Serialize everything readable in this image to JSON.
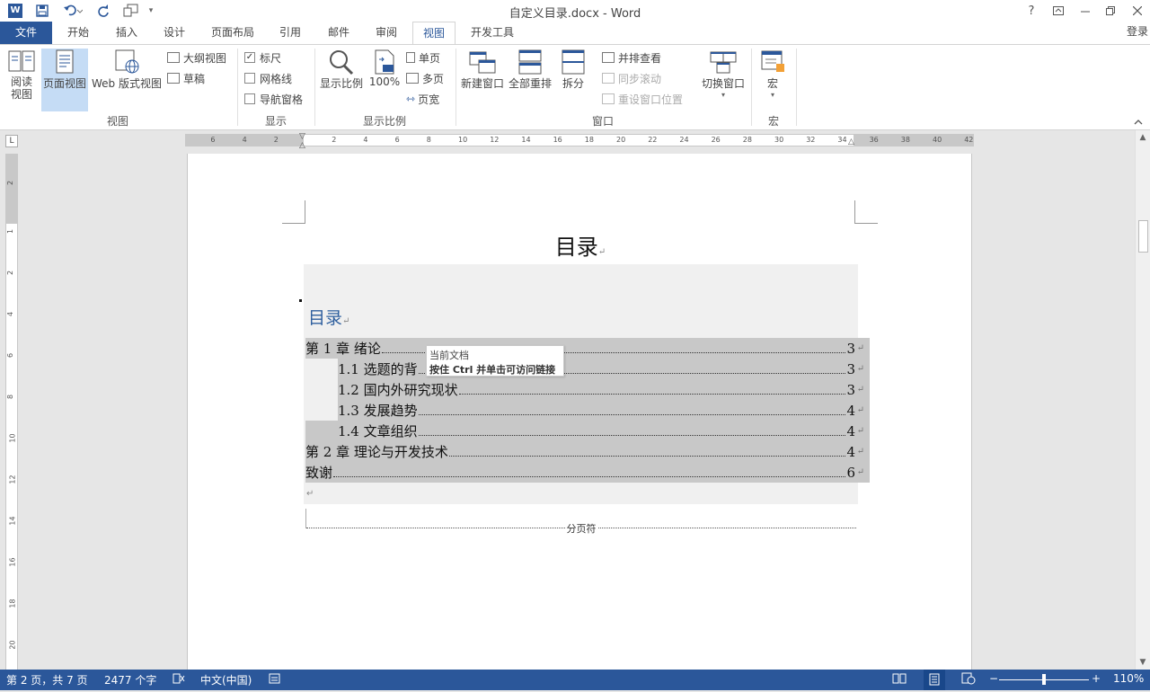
{
  "window": {
    "title": "自定义目录.docx - Word",
    "help": "?",
    "login": "登录"
  },
  "qat": {
    "word_icon": "W"
  },
  "tabs": [
    "文件",
    "开始",
    "插入",
    "设计",
    "页面布局",
    "引用",
    "邮件",
    "审阅",
    "视图",
    "开发工具"
  ],
  "ribbon": {
    "views": {
      "read": "阅读\n视图",
      "print_layout": "页面视图",
      "web_layout": "Web 版式视图",
      "outline": "大纲视图",
      "draft": "草稿",
      "label": "视图"
    },
    "show": {
      "ruler": "标尺",
      "ruler_checked": true,
      "gridlines": "网格线",
      "nav_pane": "导航窗格",
      "label": "显示"
    },
    "zoom": {
      "zoom": "显示比例",
      "hundred": "100%",
      "one_page": "单页",
      "multi_page": "多页",
      "page_width": "页宽",
      "label": "显示比例"
    },
    "window": {
      "new_window": "新建窗口",
      "arrange_all": "全部重排",
      "split": "拆分",
      "side_by_side": "并排查看",
      "sync_scroll": "同步滚动",
      "reset_position": "重设窗口位置",
      "switch_windows": "切换窗口",
      "label": "窗口"
    },
    "macros": {
      "macros": "宏",
      "label": "宏"
    }
  },
  "ruler": {
    "h_labels": [
      "6",
      "4",
      "2",
      "2",
      "4",
      "6",
      "8",
      "10",
      "12",
      "14",
      "16",
      "18",
      "20",
      "22",
      "24",
      "26",
      "28",
      "30",
      "32",
      "34",
      "36",
      "38",
      "40",
      "42"
    ],
    "v_labels": [
      "2",
      "1",
      "2",
      "4",
      "6",
      "8",
      "10",
      "12",
      "14",
      "16",
      "18",
      "20"
    ]
  },
  "document": {
    "title": "目录",
    "toc_heading": "目录",
    "toc": [
      {
        "text": "第 1 章  绪论",
        "page": "3",
        "indent": false
      },
      {
        "text": "1.1 选题的背",
        "page": "3",
        "indent": true
      },
      {
        "text": "1.2 国内外研究现状",
        "page": "3",
        "indent": true
      },
      {
        "text": "1.3 发展趋势",
        "page": "4",
        "indent": true
      },
      {
        "text": "1.4 文章组织",
        "page": "4",
        "indent": true
      },
      {
        "text": "第 2 章   理论与开发技术",
        "page": "4",
        "indent": false
      },
      {
        "text": "致谢",
        "page": "6",
        "indent": false
      }
    ],
    "tooltip": {
      "line1": "当前文档",
      "line2": "按住 Ctrl 并单击可访问链接"
    },
    "page_break": "分页符",
    "para_mark": "↵"
  },
  "status": {
    "page": "第 2 页，共 7 页",
    "words": "2477 个字",
    "language": "中文(中国)",
    "zoom_pct": "110%",
    "zoom_level": 0.5
  },
  "colors": {
    "accent": "#2b579a",
    "toc_heading": "#2e5f9e"
  }
}
